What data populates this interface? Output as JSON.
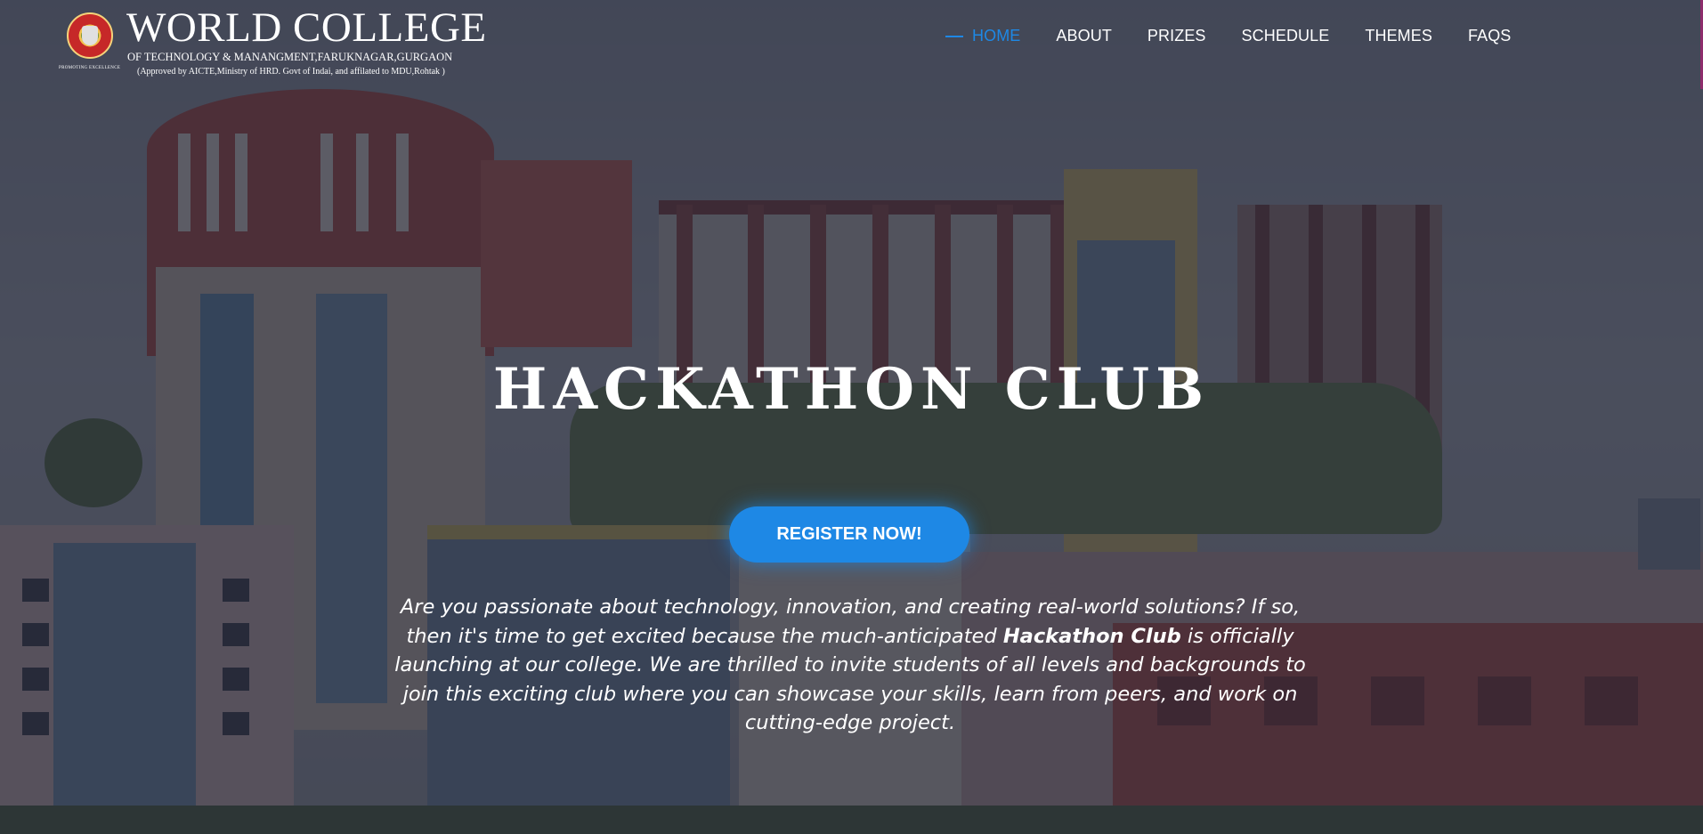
{
  "header": {
    "logo_icon": "college-crest-icon",
    "logo_tagline": "PROMOTING EXCELLENCE",
    "title": "WORLD COLLEGE",
    "subtitle": "OF TECHNOLOGY & MANANGMENT,FARUKNAGAR,GURGAON",
    "approval_note": "(Approved by AICTE,Ministry of HRD. Govt of Indai, and affilated to MDU,Rohtak )"
  },
  "nav": {
    "active_item": "HOME",
    "items": [
      {
        "label": "HOME"
      },
      {
        "label": "ABOUT"
      },
      {
        "label": "PRIZES"
      },
      {
        "label": "SCHEDULE"
      },
      {
        "label": "THEMES"
      },
      {
        "label": "FAQS"
      }
    ]
  },
  "hero": {
    "title": "HACKATHON CLUB",
    "register_label": "REGISTER NOW!",
    "description_before": "Are you passionate about technology, innovation, and creating real-world solutions? If so, then it's time to get excited because the much-anticipated ",
    "description_highlight": "Hackathon Club",
    "description_after": " is officially launching at our college. We are thrilled to invite students of all levels and backgrounds to join this exciting club where you can showcase your skills, learn from peers, and work on cutting-edge project."
  },
  "colors": {
    "accent": "#1e88e5",
    "overlay": "#262837",
    "text": "#ffffff"
  }
}
